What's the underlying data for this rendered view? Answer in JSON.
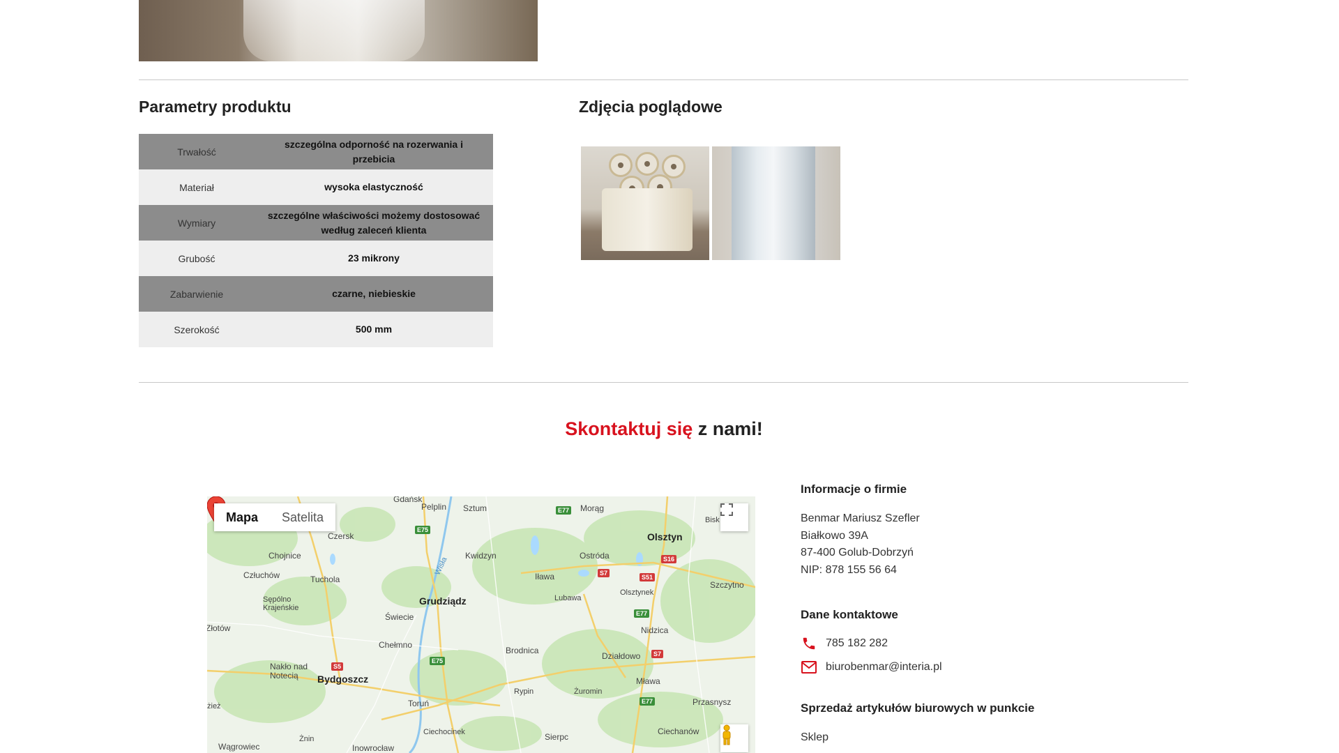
{
  "params_section": {
    "title": "Parametry produktu",
    "rows": [
      {
        "key": "Trwałość",
        "value": "szczególna odporność na rozerwania i przebicia"
      },
      {
        "key": "Materiał",
        "value": "wysoka elastyczność"
      },
      {
        "key": "Wymiary",
        "value": "szczególne właściwości możemy dostosować według zaleceń klienta"
      },
      {
        "key": "Grubość",
        "value": "23 mikrony"
      },
      {
        "key": "Zabarwienie",
        "value": "czarne, niebieskie"
      },
      {
        "key": "Szerokość",
        "value": "500 mm"
      }
    ]
  },
  "gallery": {
    "title": "Zdjęcia poglądowe"
  },
  "contact": {
    "title_red": "Skontaktuj się",
    "title_dark": " z nami!"
  },
  "map": {
    "tab_map": "Mapa",
    "tab_satellite": "Satelita",
    "places": [
      "Gdańsk",
      "Pelplin",
      "Sztum",
      "Morąg",
      "Czersk",
      "Olsztyn",
      "Chojnice",
      "Kwidzyn",
      "Ostróda",
      "Człuchów",
      "Tuchola",
      "Iława",
      "Szczytno",
      "Sępólno Krajeńskie",
      "Grudziądz",
      "Lubawa",
      "Olsztynek",
      "Świecie",
      "Złotów",
      "Nidzica",
      "Chełmno",
      "Brodnica",
      "Działdowo",
      "Nakło nad Notecią",
      "Bydgoszcz",
      "Mława",
      "Rypin",
      "Żuromin",
      "Toruń",
      "Przasnysz",
      "Ciechanów",
      "Ciechocinek",
      "Sierpc",
      "Żnin",
      "Wągrowiec",
      "Inowrocław",
      "Wisła",
      "Bisk",
      "żież"
    ],
    "roads": [
      "E77",
      "E75",
      "S16",
      "S7",
      "S51",
      "E77",
      "E75",
      "S5",
      "S7",
      "E77"
    ]
  },
  "company": {
    "heading": "Informacje o firmie",
    "name": "Benmar Mariusz Szefler",
    "street": "Białkowo 39A",
    "city": "87-400 Golub-Dobrzyń",
    "nip": "NIP: 878 155 56 64"
  },
  "contact_data": {
    "heading": "Dane kontaktowe",
    "phone": "785 182 282",
    "email": "biurobenmar@interia.pl",
    "phone_icon": "phone-icon",
    "email_icon": "mail-icon",
    "accent_color": "#d8121e"
  },
  "sales": {
    "heading": "Sprzedaż artykułów biurowych w punkcie",
    "shop": "Sklep"
  }
}
